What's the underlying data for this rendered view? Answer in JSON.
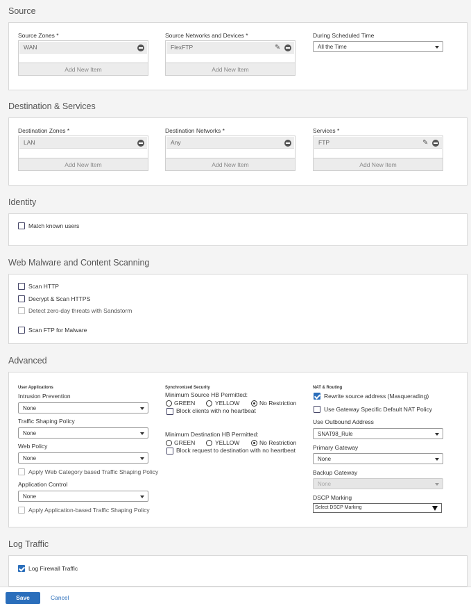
{
  "source": {
    "title": "Source",
    "zones": {
      "label": "Source Zones *",
      "item": "WAN",
      "add": "Add New Item"
    },
    "networks": {
      "label": "Source Networks and Devices *",
      "item": "FlexFTP",
      "add": "Add New Item"
    },
    "schedule": {
      "label": "During Scheduled Time",
      "value": "All the Time"
    }
  },
  "destination": {
    "title": "Destination & Services",
    "zones": {
      "label": "Destination Zones *",
      "item": "LAN",
      "add": "Add New Item"
    },
    "networks": {
      "label": "Destination Networks *",
      "item": "Any",
      "add": "Add New Item"
    },
    "services": {
      "label": "Services *",
      "item": "FTP",
      "add": "Add New Item"
    }
  },
  "identity": {
    "title": "Identity",
    "match_known_users": {
      "label": "Match known users",
      "checked": false
    }
  },
  "malware": {
    "title": "Web Malware and Content Scanning",
    "scan_http": "Scan HTTP",
    "decrypt_https": "Decrypt & Scan HTTPS",
    "zero_day": "Detect zero-day threats with Sandstorm",
    "scan_ftp": "Scan FTP for Malware"
  },
  "advanced": {
    "title": "Advanced",
    "user_apps": {
      "heading": "User Applications",
      "ips_label": "Intrusion Prevention",
      "ips_value": "None",
      "shaping_label": "Traffic Shaping Policy",
      "shaping_value": "None",
      "web_label": "Web Policy",
      "web_value": "None",
      "web_cat_shaping": "Apply Web Category based Traffic Shaping Policy",
      "appctrl_label": "Application Control",
      "appctrl_value": "None",
      "app_shaping": "Apply Application-based Traffic Shaping Policy"
    },
    "sync_sec": {
      "heading": "Synchronized Security",
      "min_src_label": "Minimum Source HB Permitted:",
      "green": "GREEN",
      "yellow": "YELLOW",
      "no_restriction": "No Restriction",
      "block_clients": "Block clients with no heartbeat",
      "min_dst_label": "Minimum Destination HB Permitted:",
      "block_dest": "Block request to destination with no heartbeat",
      "src_selected": "No Restriction",
      "dst_selected": "No Restriction"
    },
    "nat": {
      "heading": "NAT & Routing",
      "rewrite": "Rewrite source address (Masquerading)",
      "rewrite_checked": true,
      "gateway_nat": "Use Gateway Specific Default NAT Policy",
      "outbound_label": "Use Outbound Address",
      "outbound_value": "SNAT98_Rule",
      "primary_gw_label": "Primary Gateway",
      "primary_gw_value": "None",
      "backup_gw_label": "Backup Gateway",
      "backup_gw_value": "None",
      "dscp_label": "DSCP Marking",
      "dscp_value": "Select DSCP Marking"
    }
  },
  "log": {
    "title": "Log Traffic",
    "log_firewall": "Log Firewall Traffic",
    "log_checked": true
  },
  "footer": {
    "save": "Save",
    "cancel": "Cancel"
  },
  "colors": {
    "accent": "#2a6ebb",
    "panel_bg": "#ffffff",
    "page_bg": "#f4f4f4"
  }
}
